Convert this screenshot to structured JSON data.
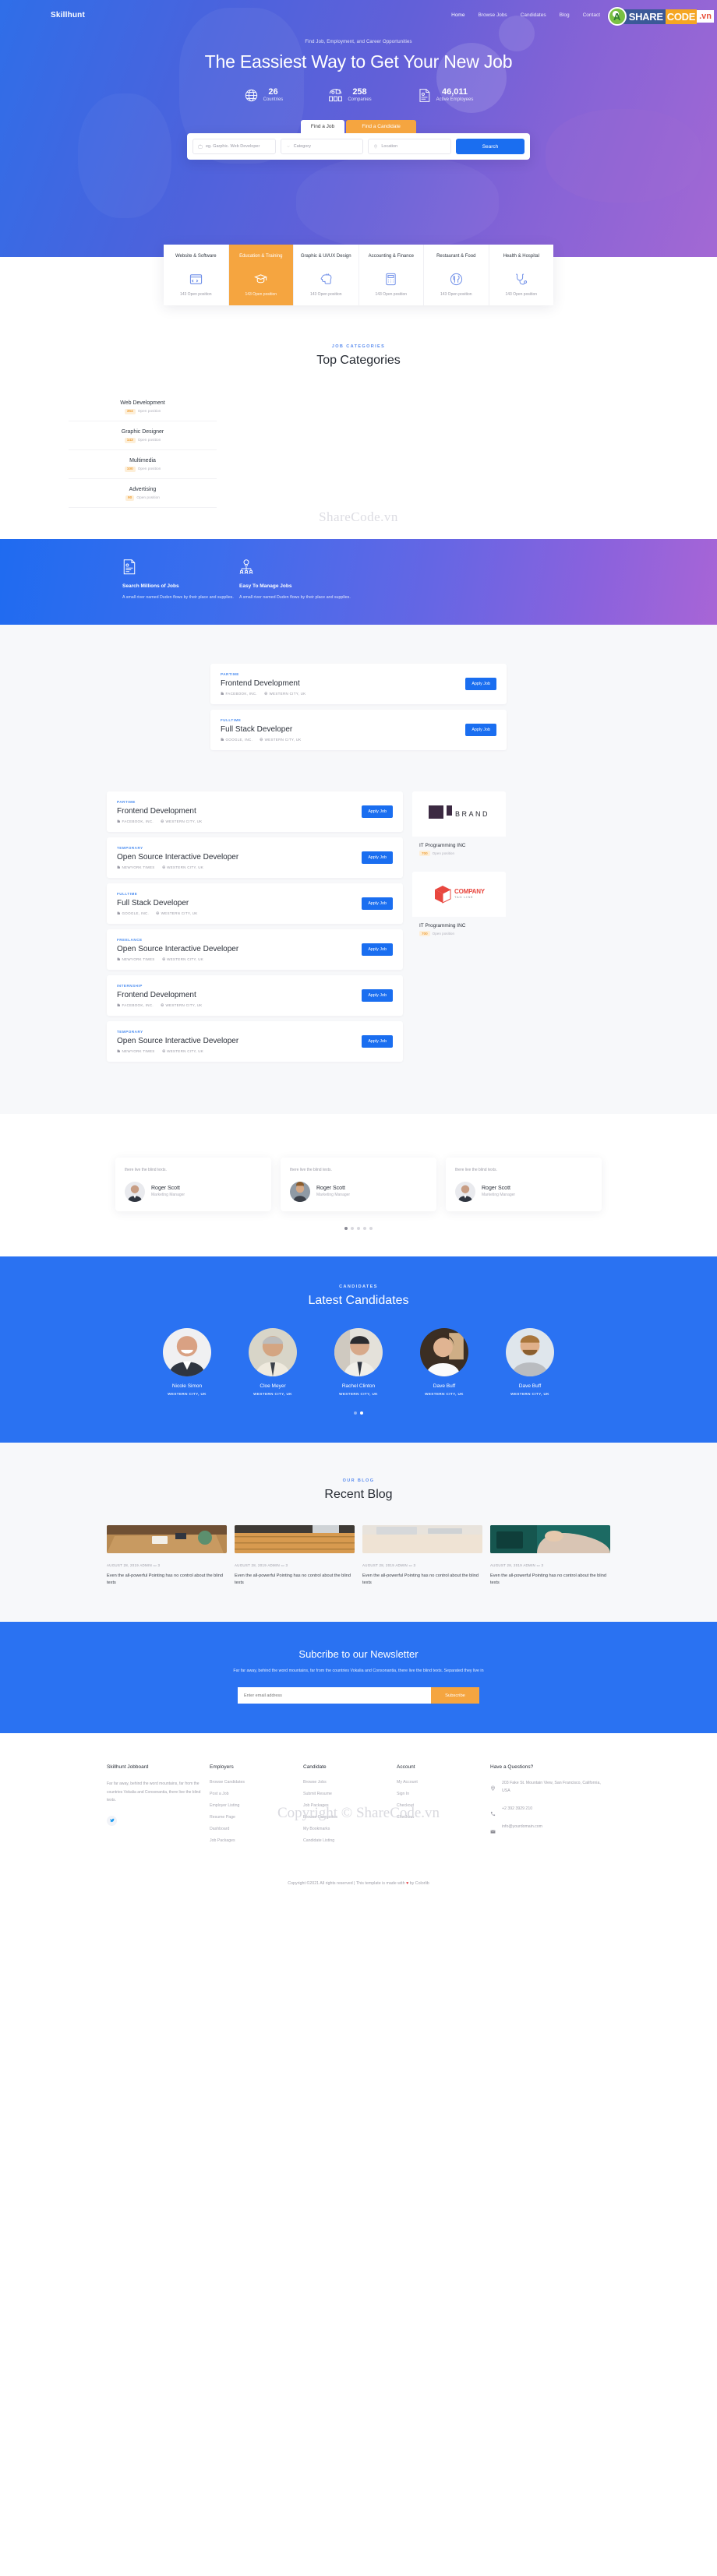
{
  "site": {
    "brand": "Skillhunt"
  },
  "nav": {
    "items": [
      {
        "label": "Home",
        "active": true
      },
      {
        "label": "Browse Jobs",
        "active": false
      },
      {
        "label": "Candidates",
        "active": false
      },
      {
        "label": "Blog",
        "active": false
      },
      {
        "label": "Contact",
        "active": false
      }
    ]
  },
  "watermark": {
    "a": "A",
    "share": "SHARE",
    "code": "CODE",
    "vn": ".vn"
  },
  "hero": {
    "subtitle": "Find Job, Employment, and Career Opportunities",
    "title": "The Eassiest Way to Get Your New Job",
    "stats": [
      {
        "icon": "globe-icon",
        "number": "26",
        "label": "Countries"
      },
      {
        "icon": "companies-icon",
        "number": "258",
        "label": "Companies"
      },
      {
        "icon": "resume-icon",
        "number": "46,011",
        "label": "Active Employees"
      }
    ]
  },
  "search": {
    "tabs": [
      {
        "label": "Find a Job",
        "active": true
      },
      {
        "label": "Find a Candidate",
        "active": false
      }
    ],
    "keyword_placeholder": "eg. Garphic. Web Developer",
    "category_placeholder": "Category",
    "location_placeholder": "Location",
    "button": "Search"
  },
  "categories_strip": [
    {
      "name": "Website & Software",
      "icon": "browser-code-icon",
      "positions": "143 Open position",
      "active": false
    },
    {
      "name": "Education & Training",
      "icon": "graduation-cap-icon",
      "positions": "143 Open position",
      "active": true
    },
    {
      "name": "Graphic & UI/UX Design",
      "icon": "brain-idea-icon",
      "positions": "143 Open position",
      "active": false
    },
    {
      "name": "Accounting & Finance",
      "icon": "calculator-icon",
      "positions": "143 Open position",
      "active": false
    },
    {
      "name": "Restaurant & Food",
      "icon": "cutlery-icon",
      "positions": "143 Open position",
      "active": false
    },
    {
      "name": "Health & Hospital",
      "icon": "stethoscope-icon",
      "positions": "143 Open position",
      "active": false
    }
  ],
  "top_categories": {
    "kicker": "JOB CATEGORIES",
    "title": "Top Categories",
    "ghost_text": "ShareCode.vn",
    "items": [
      {
        "name": "Web Development",
        "count": "354",
        "suffix": "Open position"
      },
      {
        "name": "Graphic Designer",
        "count": "143",
        "suffix": "Open position"
      },
      {
        "name": "Multimedia",
        "count": "100",
        "suffix": "Open position"
      },
      {
        "name": "Advertising",
        "count": "90",
        "suffix": "Open position"
      }
    ]
  },
  "band": {
    "features": [
      {
        "icon": "resume-doc-icon",
        "title": "Search Millions of Jobs",
        "text": "A small river named Duden flows by their place and supplies."
      },
      {
        "icon": "manage-team-icon",
        "title": "Easy To Manage Jobs",
        "text": "A small river named Duden flows by their place and supplies."
      }
    ]
  },
  "jobs_primary": [
    {
      "tag": "PARTIME",
      "title": "Frontend Development",
      "company": "FACEBOOK, INC.",
      "location": "WESTERN CITY, UK",
      "apply": "Apply Job"
    },
    {
      "tag": "FULLTIME",
      "title": "Full Stack Developer",
      "company": "GOOGLE, INC.",
      "location": "WESTERN CITY, UK",
      "apply": "Apply Job"
    }
  ],
  "jobs_secondary": [
    {
      "tag": "PARTIME",
      "title": "Frontend Development",
      "company": "FACEBOOK, INC.",
      "location": "WESTERN CITY, UK",
      "apply": "Apply Job"
    },
    {
      "tag": "TEMPORARY",
      "title": "Open Source Interactive Developer",
      "company": "NEWYORK TIMES",
      "location": "WESTERN CITY, UK",
      "apply": "Apply Job"
    },
    {
      "tag": "FULLTIME",
      "title": "Full Stack Developer",
      "company": "GOOGLE, INC.",
      "location": "WESTERN CITY, UK",
      "apply": "Apply Job"
    },
    {
      "tag": "FREELANCE",
      "title": "Open Source Interactive Developer",
      "company": "NEWYORK TIMES",
      "location": "WESTERN CITY, UK",
      "apply": "Apply Job"
    },
    {
      "tag": "INTERNSHIP",
      "title": "Frontend Development",
      "company": "FACEBOOK, INC.",
      "location": "WESTERN CITY, UK",
      "apply": "Apply Job"
    },
    {
      "tag": "TEMPORARY",
      "title": "Open Source Interactive Developer",
      "company": "NEWYORK TIMES",
      "location": "WESTERN CITY, UK",
      "apply": "Apply Job"
    }
  ],
  "brand_cards": [
    {
      "logo": "brand-logo",
      "word": "BRAND",
      "name": "IT Programming INC",
      "count": "700",
      "suffix": "Open position"
    },
    {
      "logo": "company-cube-logo",
      "word": "COMPANY",
      "tagline": "TAG LINE",
      "name": "IT Programming INC",
      "count": "700",
      "suffix": "Open position"
    }
  ],
  "testimonials": [
    {
      "text": "there live the blind texts.",
      "name": "Roger Scott",
      "role": "Marketing Manager"
    },
    {
      "text": "there live the blind texts.",
      "name": "Roger Scott",
      "role": "Marketing Manager"
    },
    {
      "text": "there live the blind texts.",
      "name": "Roger Scott",
      "role": "Marketing Manager"
    }
  ],
  "candidates": {
    "kicker": "CANDIDATES",
    "title": "Latest Candidates",
    "items": [
      {
        "name": "Nicole Simon",
        "location": "WESTERN CITY, UK"
      },
      {
        "name": "Cloe Meyer",
        "location": "WESTERN CITY, UK"
      },
      {
        "name": "Rachel Clinton",
        "location": "WESTERN CITY, UK"
      },
      {
        "name": "Dave Buff",
        "location": "WESTERN CITY, UK"
      },
      {
        "name": "Dave Buff",
        "location": "WESTERN CITY, UK"
      }
    ]
  },
  "blog": {
    "kicker": "OUR BLOG",
    "title": "Recent Blog",
    "posts": [
      {
        "date": "AUGUST 28, 2019",
        "author": "ADMIN",
        "comments": "3",
        "title": "Even the all-powerful Pointing has no control about the blind texts"
      },
      {
        "date": "AUGUST 28, 2019",
        "author": "ADMIN",
        "comments": "3",
        "title": "Even the all-powerful Pointing has no control about the blind texts"
      },
      {
        "date": "AUGUST 28, 2019",
        "author": "ADMIN",
        "comments": "3",
        "title": "Even the all-powerful Pointing has no control about the blind texts"
      },
      {
        "date": "AUGUST 28, 2019",
        "author": "ADMIN",
        "comments": "3",
        "title": "Even the all-powerful Pointing has no control about the blind texts"
      }
    ]
  },
  "newsletter": {
    "title": "Subcribe to our Newsletter",
    "text": "Far far away, behind the word mountains, far from the countries Vokalia and Consonantia, there live the blind texts. Separated they live in",
    "placeholder": "Enter email address",
    "button": "Subscribe"
  },
  "footer": {
    "ghost_text": "Copyright © ShareCode.vn",
    "about": {
      "heading": "Skillhunt Jobboard",
      "text": "Far far away, behind the word mountains, far from the countries Vokalia and Consonantia, there live the blind texts.",
      "social": "twitter-icon"
    },
    "employers": {
      "heading": "Employers",
      "links": [
        "Browse Candidates",
        "Post a Job",
        "Employer Listing",
        "Resume Page",
        "Dashboard",
        "Job Packages"
      ]
    },
    "candidate": {
      "heading": "Candidate",
      "links": [
        "Browse Jobs",
        "Submit Resume",
        "Job Packages",
        "Browse Categories",
        "My Bookmarks",
        "Candidate Listing"
      ]
    },
    "account": {
      "heading": "Account",
      "links": [
        "My Account",
        "Sign In",
        "Checkout",
        "Checkout"
      ]
    },
    "questions": {
      "heading": "Have a Questions?",
      "address": "203 Fake St. Mountain View, San Francisco, California, USA",
      "phone": "+2 392 3929 210",
      "email": "info@yourdomain.com"
    },
    "copyright_pre": "Copyright ©2021 All rights reserved | This template is made with ",
    "copyright_post": " by Colorlib"
  }
}
